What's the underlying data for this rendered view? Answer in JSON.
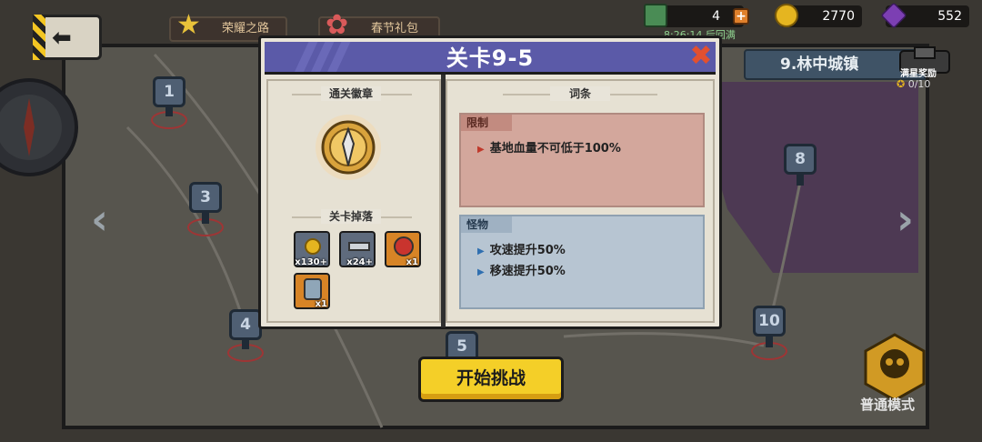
{
  "topbar": {
    "event1_label": "荣耀之路",
    "event2_label": "春节礼包",
    "energy_value": "4",
    "energy_timer": "8:26:14 后回满",
    "gold_value": "2770",
    "gem_value": "552"
  },
  "chapter": {
    "name": "9.林中城镇",
    "reward_label": "满星奖励",
    "star_progress": "0/10"
  },
  "map_pins": [
    {
      "number": "1"
    },
    {
      "number": "3"
    },
    {
      "number": "4"
    },
    {
      "number": "5"
    },
    {
      "number": "8"
    },
    {
      "number": "10"
    }
  ],
  "modal": {
    "title": "关卡9-5",
    "badge_tag": "通关徽章",
    "drops_tag": "关卡掉落",
    "terms_tag": "词条",
    "drops": [
      {
        "icon": "gold-coin-icon",
        "count": "x130+"
      },
      {
        "icon": "anvil-icon",
        "count": "x24+"
      },
      {
        "icon": "mask-hero-icon",
        "count": "x1"
      },
      {
        "icon": "robot-hero-icon",
        "count": "x1"
      }
    ],
    "limit": {
      "label": "限制",
      "items": [
        "基地血量不可低于100%"
      ]
    },
    "monster": {
      "label": "怪物",
      "items": [
        "攻速提升50%",
        "移速提升50%"
      ]
    }
  },
  "start_button": "开始挑战",
  "mode": {
    "label": "普通模式"
  },
  "colors": {
    "title_bar": "#5b5aa8",
    "limit_bg": "#d3a79c",
    "monster_bg": "#b7c5d2",
    "start_btn": "#f4cf28",
    "close_x": "#e2502f"
  }
}
